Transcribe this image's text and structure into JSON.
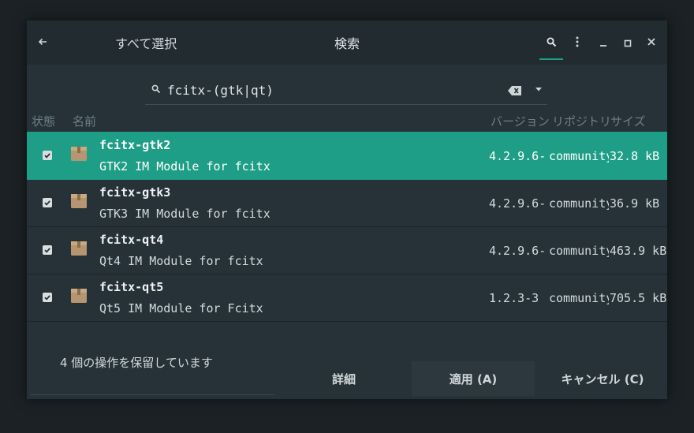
{
  "header": {
    "back_icon": "arrow-left-icon",
    "select_all": "すべて選択",
    "title": "検索",
    "search_icon": "search-icon",
    "menu_icon": "vertical-dots-icon",
    "minimize_icon": "minimize-icon",
    "maximize_icon": "maximize-icon",
    "close_icon": "close-icon",
    "accent": "#1e9e86"
  },
  "search": {
    "value": "fcitx-(gtk|qt)",
    "clear_icon": "backspace-icon",
    "dropdown_icon": "chevron-down-icon"
  },
  "columns": {
    "state": "状態",
    "name": "名前",
    "version": "バージョン",
    "repository": "リポジトリ",
    "size": "サイズ"
  },
  "packages": [
    {
      "name": "fcitx-gtk2",
      "description": "GTK2 IM Module for fcitx",
      "version": "4.2.9.6-",
      "repository": "community",
      "size": "32.8 kB",
      "checked": true,
      "selected": true
    },
    {
      "name": "fcitx-gtk3",
      "description": "GTK3 IM Module for fcitx",
      "version": "4.2.9.6-",
      "repository": "community",
      "size": "36.9 kB",
      "checked": true,
      "selected": false
    },
    {
      "name": "fcitx-qt4",
      "description": "Qt4 IM Module for fcitx",
      "version": "4.2.9.6-",
      "repository": "community",
      "size": "463.9 kB",
      "checked": true,
      "selected": false
    },
    {
      "name": "fcitx-qt5",
      "description": "Qt5 IM Module for Fcitx",
      "version": "1.2.3-3",
      "repository": "community",
      "size": "705.5 kB",
      "checked": true,
      "selected": false
    }
  ],
  "footer": {
    "pending": "4 個の操作を保留しています",
    "details": "詳細",
    "apply": "適用 (A)",
    "cancel": "キャンセル (C)"
  }
}
